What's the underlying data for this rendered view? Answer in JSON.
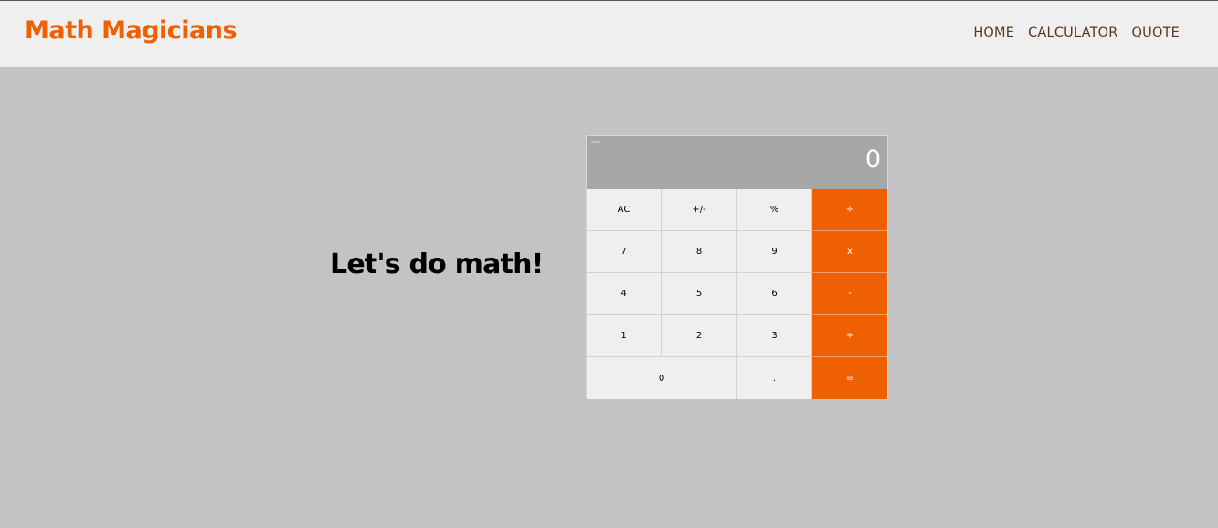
{
  "header": {
    "brand": "Math Magicians",
    "nav": [
      "HOME",
      "CALCULATOR",
      "QUOTE"
    ]
  },
  "main": {
    "headline": "Let's do math!"
  },
  "calculator": {
    "display": "0",
    "keys": {
      "ac": "AC",
      "sign": "+/-",
      "percent": "%",
      "divide": "÷",
      "seven": "7",
      "eight": "8",
      "nine": "9",
      "multiply": "x",
      "four": "4",
      "five": "5",
      "six": "6",
      "minus": "-",
      "one": "1",
      "two": "2",
      "three": "3",
      "plus": "+",
      "zero": "0",
      "dot": ".",
      "equals": "="
    }
  },
  "colors": {
    "accent": "#ee6002",
    "background": "#c3c3c3",
    "header_bg": "#efefef",
    "display_bg": "#a7a7a7",
    "nav_text": "#5a3520"
  }
}
